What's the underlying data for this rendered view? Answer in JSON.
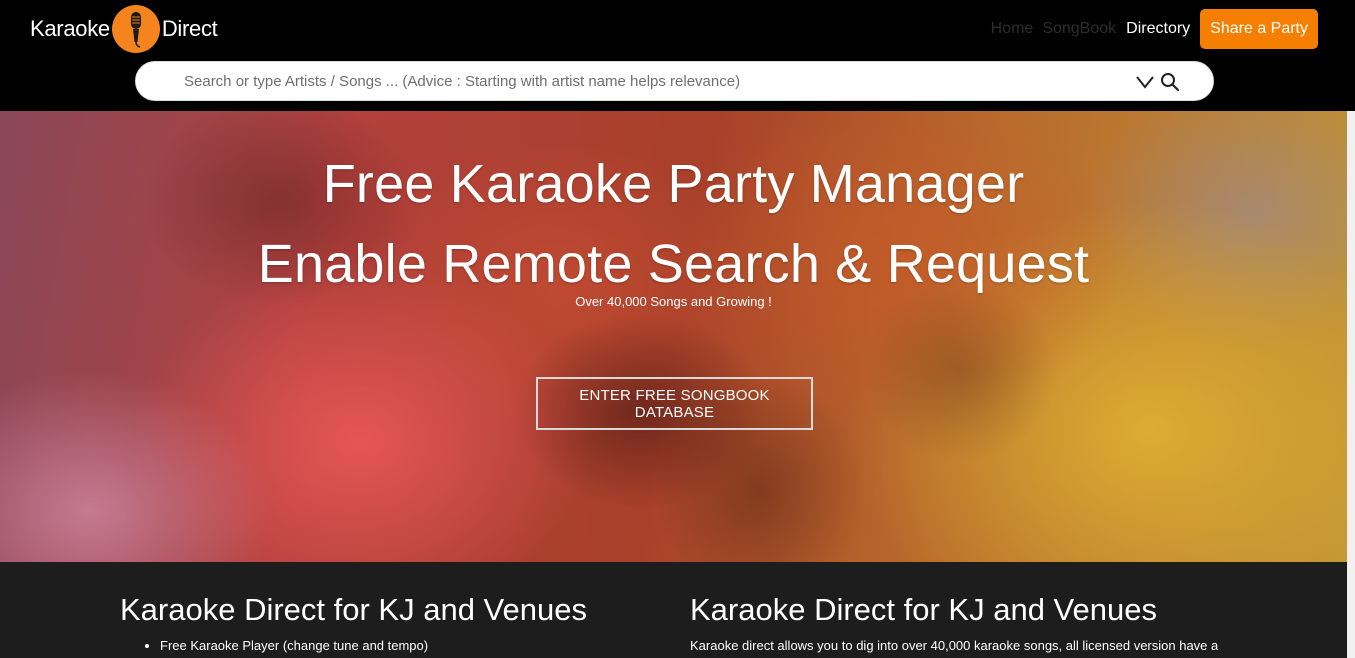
{
  "header": {
    "logo_left": "Karaoke",
    "logo_right": "Direct",
    "nav": {
      "home": "Home",
      "songbook": "SongBook",
      "directory": "Directory",
      "share": "Share a Party"
    },
    "search": {
      "placeholder": "Search or type Artists / Songs ... (Advice : Starting with artist name helps relevance)",
      "value": ""
    },
    "icons": [
      "microphone-icon",
      "chevron-down-icon",
      "search-icon"
    ],
    "colors": {
      "accent": "#f77f00",
      "nav_dim": "#2d2d2d"
    }
  },
  "hero": {
    "title_line1": "Free Karaoke Party Manager",
    "title_line2": "Enable Remote Search & Request",
    "subtitle": "Over 40,000 Songs and Growing !",
    "cta": "ENTER FREE SONGBOOK DATABASE"
  },
  "sections": {
    "left": {
      "heading": "Karaoke Direct for KJ and Venues",
      "items": [
        "Free Karaoke Player (change tune and tempo)"
      ]
    },
    "right": {
      "heading": "Karaoke Direct for KJ and Venues",
      "text": "Karaoke direct allows you to dig into over 40,000 karaoke songs, all licensed version have a"
    }
  }
}
